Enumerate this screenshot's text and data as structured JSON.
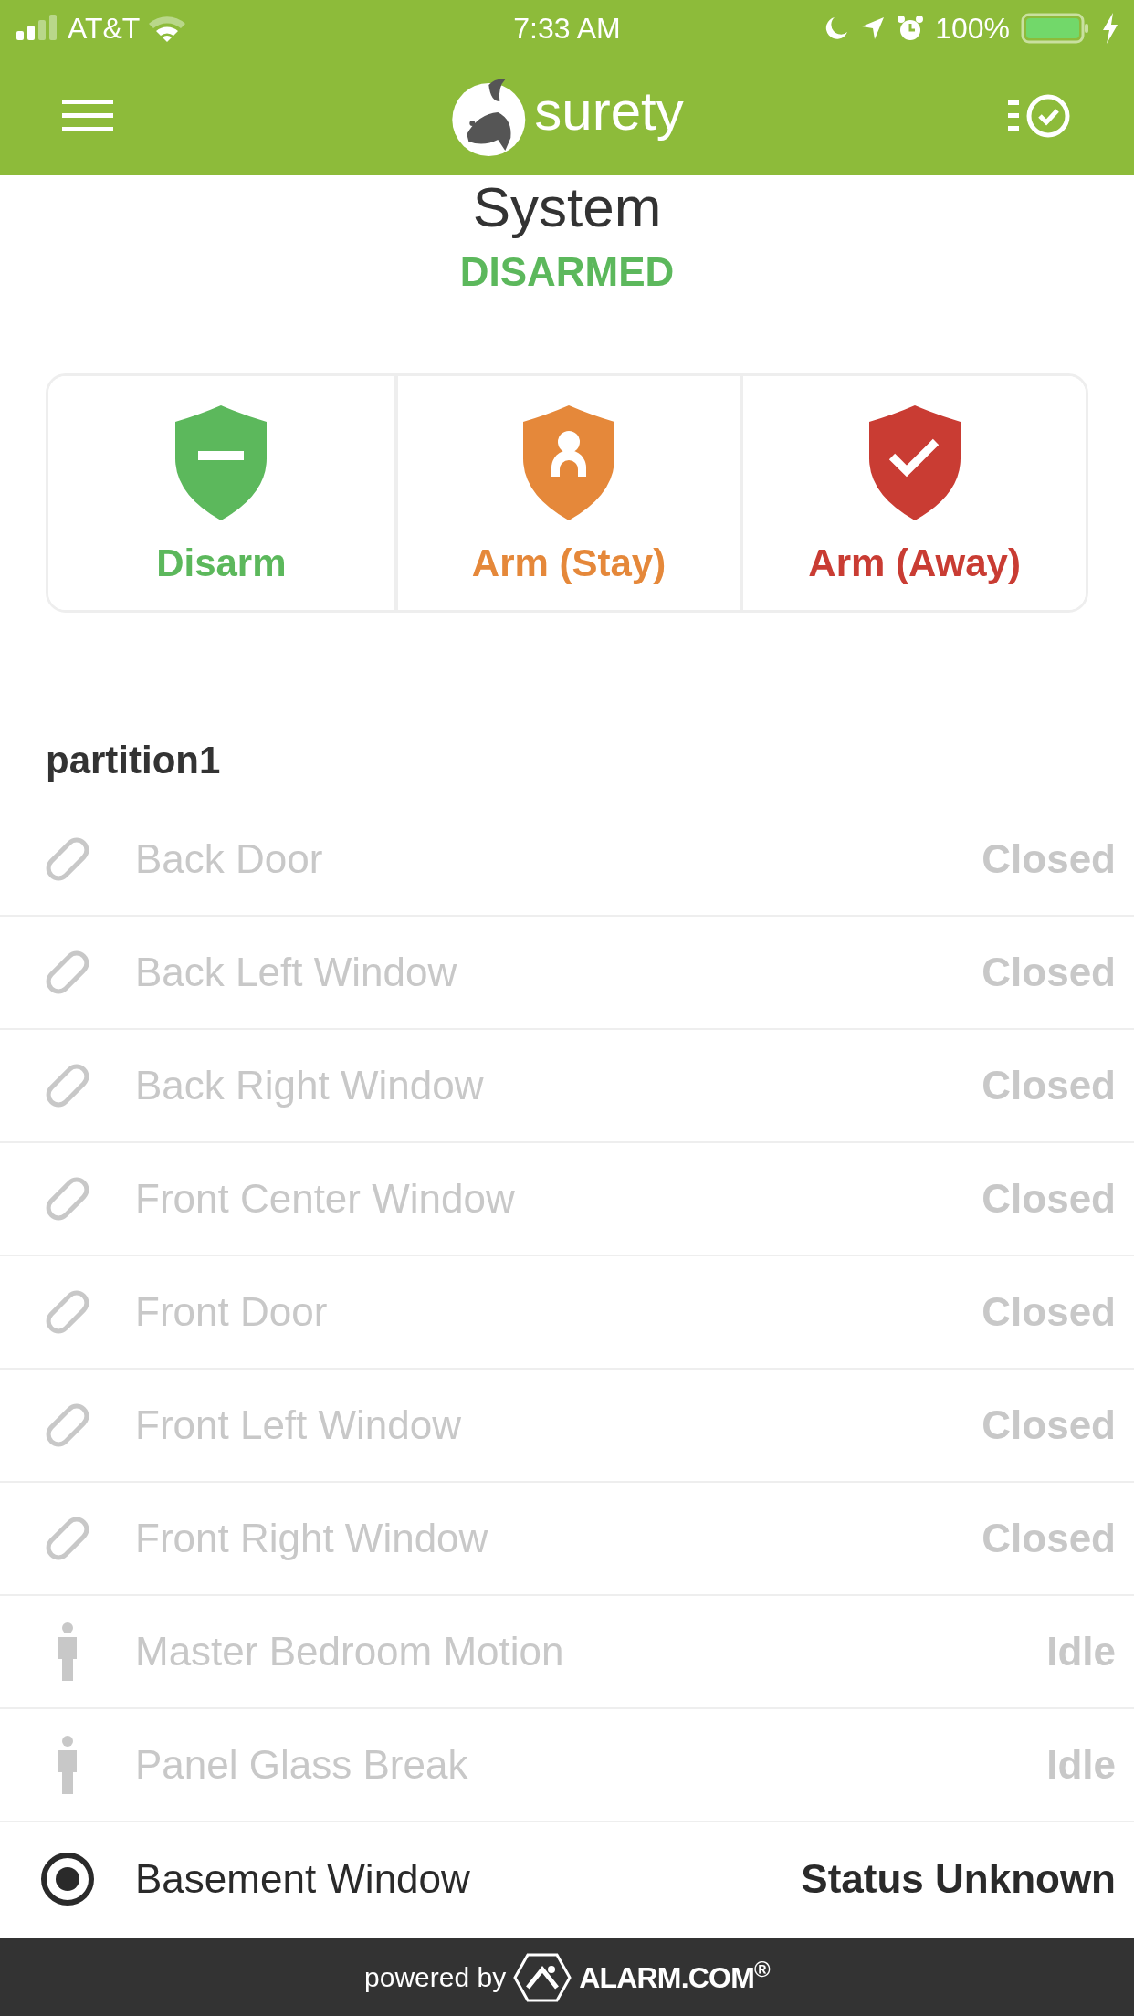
{
  "status_bar": {
    "carrier": "AT&T",
    "time": "7:33 AM",
    "battery": "100%"
  },
  "header": {
    "logo_text": "surety"
  },
  "system": {
    "title": "System",
    "state": "DISARMED"
  },
  "arm_buttons": [
    {
      "kind": "disarm",
      "label": "Disarm",
      "color": "#5cb85c"
    },
    {
      "kind": "stay",
      "label": "Arm (Stay)",
      "color": "#e5883a"
    },
    {
      "kind": "away",
      "label": "Arm (Away)",
      "color": "#c93c33"
    }
  ],
  "partition": {
    "title": "partition1",
    "sensors": [
      {
        "kind": "contact",
        "name": "Back Door",
        "status": "Closed",
        "disabled": true
      },
      {
        "kind": "contact",
        "name": "Back Left Window",
        "status": "Closed",
        "disabled": true
      },
      {
        "kind": "contact",
        "name": "Back Right Window",
        "status": "Closed",
        "disabled": true
      },
      {
        "kind": "contact",
        "name": "Front Center Window",
        "status": "Closed",
        "disabled": true
      },
      {
        "kind": "contact",
        "name": "Front Door",
        "status": "Closed",
        "disabled": true
      },
      {
        "kind": "contact",
        "name": "Front Left Window",
        "status": "Closed",
        "disabled": true
      },
      {
        "kind": "contact",
        "name": "Front Right Window",
        "status": "Closed",
        "disabled": true
      },
      {
        "kind": "motion",
        "name": "Master Bedroom Motion",
        "status": "Idle",
        "disabled": true
      },
      {
        "kind": "motion",
        "name": "Panel Glass Break",
        "status": "Idle",
        "disabled": true
      },
      {
        "kind": "unknown",
        "name": "Basement Window",
        "status": "Status Unknown",
        "disabled": false
      }
    ]
  },
  "footer": {
    "prefix": "powered by",
    "brand": "ALARM.COM$^{®}$"
  }
}
